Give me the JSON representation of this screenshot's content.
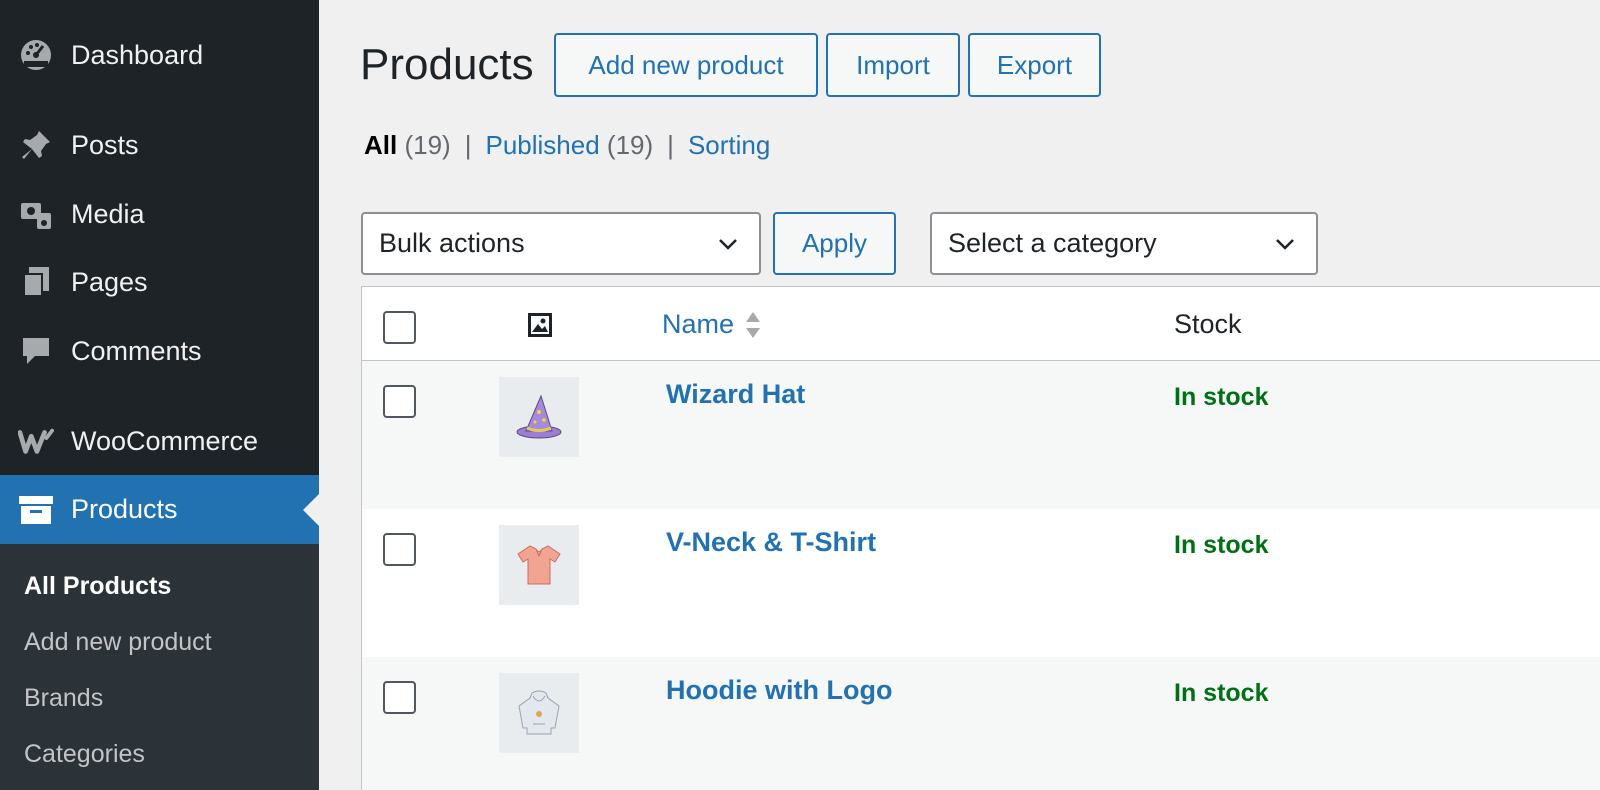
{
  "sidebar": {
    "items": [
      {
        "label": "Dashboard",
        "icon": "dashboard-icon"
      },
      {
        "label": "Posts",
        "icon": "pin-icon"
      },
      {
        "label": "Media",
        "icon": "media-icon"
      },
      {
        "label": "Pages",
        "icon": "pages-icon"
      },
      {
        "label": "Comments",
        "icon": "comment-icon"
      },
      {
        "label": "WooCommerce",
        "icon": "woocommerce-icon"
      },
      {
        "label": "Products",
        "icon": "archive-box-icon"
      }
    ],
    "submenu": [
      {
        "label": "All Products"
      },
      {
        "label": "Add new product"
      },
      {
        "label": "Brands"
      },
      {
        "label": "Categories"
      }
    ]
  },
  "header": {
    "title": "Products",
    "add_new_label": "Add new product",
    "import_label": "Import",
    "export_label": "Export"
  },
  "filters": {
    "all_label": "All",
    "all_count": "(19)",
    "published_label": "Published",
    "published_count": "(19)",
    "sorting_label": "Sorting",
    "separator": "|"
  },
  "toolbar": {
    "bulk_actions": "Bulk actions",
    "apply_label": "Apply",
    "category": "Select a category"
  },
  "table": {
    "columns": {
      "name": "Name",
      "stock": "Stock"
    },
    "rows": [
      {
        "name": "Wizard Hat",
        "stock": "In stock",
        "thumb": "wizard-hat-icon"
      },
      {
        "name": "V-Neck & T-Shirt",
        "stock": "In stock",
        "thumb": "tshirt-icon"
      },
      {
        "name": "Hoodie with Logo",
        "stock": "In stock",
        "thumb": "hoodie-icon"
      }
    ]
  },
  "colors": {
    "sidebar_bg": "#1d2327",
    "active_bg": "#2271b1",
    "link": "#2271b1",
    "in_stock": "#007017"
  }
}
